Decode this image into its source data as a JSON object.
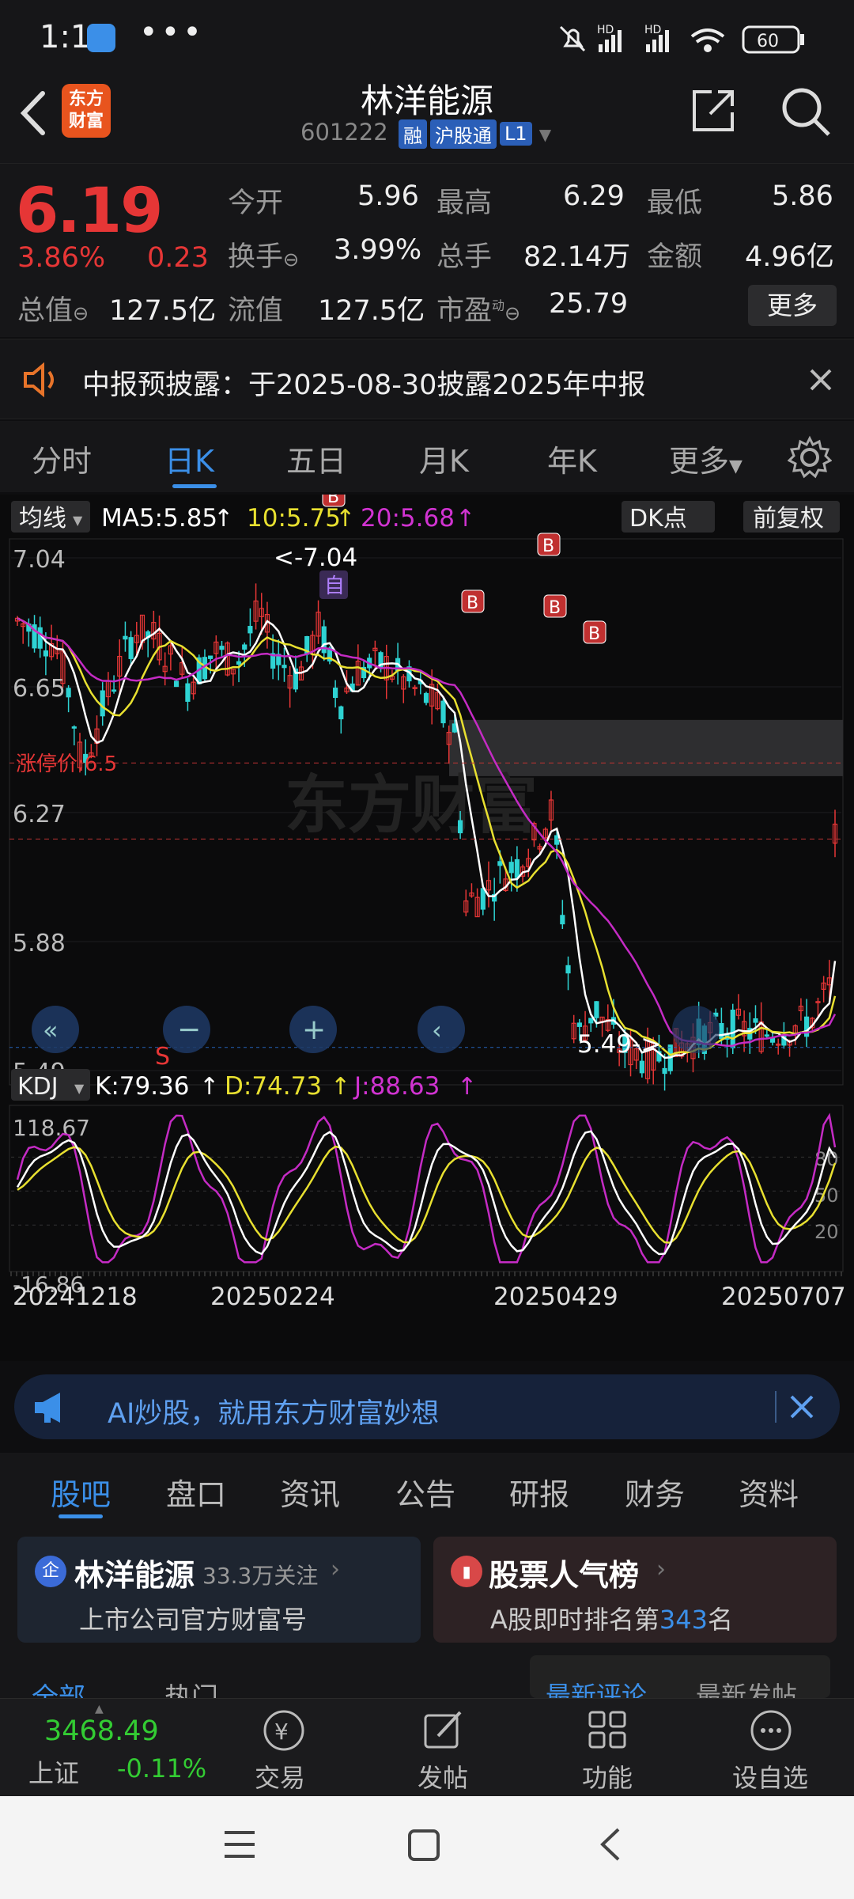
{
  "status": {
    "time": "1:11",
    "dots": "•••",
    "battery": "60",
    "hd1": "HD",
    "hd2": "HD"
  },
  "header": {
    "title": "林洋能源",
    "code": "601222",
    "tags": [
      "融",
      "沪股通",
      "L1"
    ],
    "logo": "东方财富"
  },
  "quote": {
    "price": "6.19",
    "pct": "3.86%",
    "chg": "0.23",
    "open_l": "今开",
    "open_v": "5.96",
    "high_l": "最高",
    "high_v": "6.29",
    "low_l": "最低",
    "low_v": "5.86",
    "turn_l": "换手",
    "turn_v": "3.99%",
    "vol_l": "总手",
    "vol_v": "82.14万",
    "amt_l": "金额",
    "amt_v": "4.96亿",
    "mcap_l": "总值",
    "mcap_v": "127.5亿",
    "float_l": "流值",
    "float_v": "127.5亿",
    "pe_l": "市盈",
    "pe_sup": "动",
    "pe_v": "25.79",
    "more": "更多"
  },
  "notice": {
    "text": "中报预披露：于2025-08-30披露2025年中报"
  },
  "ktabs": [
    "分时",
    "日K",
    "五日",
    "月K",
    "年K",
    "更多"
  ],
  "chart_head": {
    "ma_btn": "均线",
    "ma5": "MA5:5.85",
    "ma10": "10:5.75",
    "ma20": "20:5.68",
    "dk": "DK点",
    "fq": "前复权",
    "limit": "涨停价:6.5",
    "hi_label": "<-7.04",
    "lo_label": "5.49->",
    "zi": "自",
    "kdj_btn": "KDJ",
    "k": "K:79.36",
    "d": "D:74.73",
    "j": "J:88.63",
    "watermark": "东方财富",
    "s_label": "S"
  },
  "kdj_axis": {
    "max": "118.67",
    "min": "-16.86",
    "l80": "80",
    "l50": "50",
    "l20": "20"
  },
  "chart_data": {
    "type": "candlestick",
    "y_ticks": [
      "7.04",
      "6.65",
      "6.27",
      "5.88",
      "5.49"
    ],
    "ylim": [
      5.49,
      7.04
    ],
    "x_ticks": [
      "20241218",
      "20250224",
      "20250429",
      "20250707"
    ],
    "series": [
      {
        "name": "MA5",
        "value": "5.85"
      },
      {
        "name": "10",
        "value": "5.75"
      },
      {
        "name": "20",
        "value": "5.68"
      }
    ],
    "kdj": {
      "K": 79.36,
      "D": 74.73,
      "J": 88.63,
      "ylim": [
        -16.86,
        118.67
      ]
    },
    "bands": [
      {
        "from": 6.38,
        "to": 6.55
      }
    ],
    "markers": [
      {
        "t": "B"
      },
      {
        "t": "S"
      },
      {
        "t": "S"
      },
      {
        "t": "S"
      },
      {
        "t": "B"
      },
      {
        "t": "B"
      },
      {
        "t": "B"
      },
      {
        "t": "B"
      },
      {
        "t": "B"
      }
    ]
  },
  "ai": {
    "text": "AI炒股，就用东方财富妙想"
  },
  "subtabs": [
    "股吧",
    "盘口",
    "资讯",
    "公告",
    "研报",
    "财务",
    "资料"
  ],
  "cards": [
    {
      "title": "林洋能源",
      "follow": "33.3万关注",
      "sub": "上市公司官方财富号"
    },
    {
      "title": "股票人气榜",
      "sub_pre": "A股即时排名第",
      "rank": "343",
      "sub_post": "名"
    }
  ],
  "peek": {
    "a": "全部",
    "b": "热门",
    "c": "最新评论",
    "d": "最新发帖"
  },
  "bottom": {
    "index_v": "3468.49",
    "index_n": "上证",
    "index_c": "-0.11%",
    "items": [
      "交易",
      "发帖",
      "功能",
      "设自选"
    ]
  },
  "colors": {
    "up": "#e63636",
    "down": "#2ed3d3",
    "ma5": "#ffffff",
    "ma10": "#e8e030",
    "ma20": "#c42bc4",
    "accent": "#3b8fe8"
  }
}
